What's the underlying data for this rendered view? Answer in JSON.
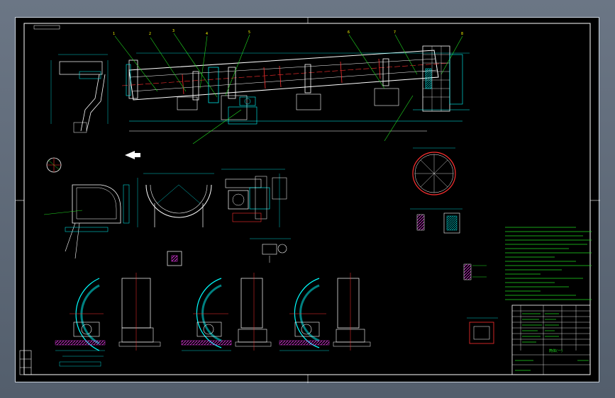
{
  "window": {
    "background": "#5a6675"
  },
  "drawing": {
    "background": "#000000",
    "colors": {
      "cyan": "#00ffff",
      "white": "#ffffff",
      "yellow": "#ffff00",
      "red": "#ff3030",
      "green": "#22dd22",
      "magenta": "#ff40ff",
      "blue": "#3070ff"
    },
    "title_block": {
      "title": "筒体(一)"
    }
  }
}
